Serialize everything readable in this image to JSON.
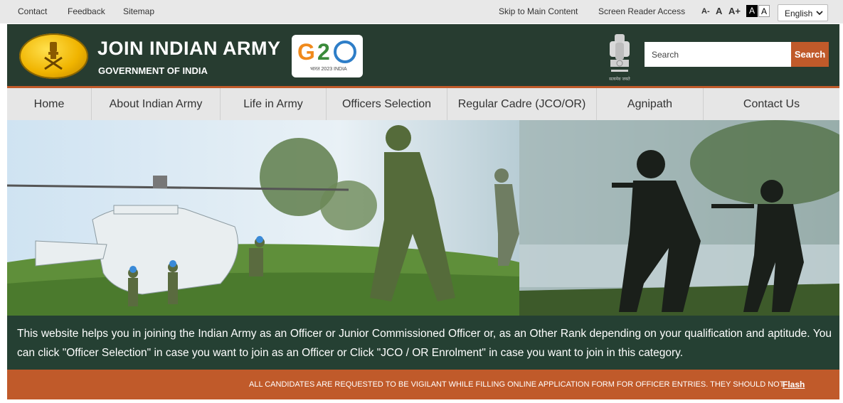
{
  "topbar": {
    "links": [
      "Contact",
      "Feedback",
      "Sitemap"
    ],
    "skip_link": "Skip to Main Content",
    "screen_reader": "Screen Reader Access",
    "font_decrease": "A-",
    "font_normal": "A",
    "font_increase": "A+",
    "contrast_dark": "A",
    "contrast_light": "A",
    "language": "English"
  },
  "header": {
    "title": "JOIN INDIAN ARMY",
    "subtitle": "GOVERNMENT OF INDIA",
    "g20_logo": "G20",
    "emblem_icon": "indian-army-emblem",
    "national_emblem_icon": "ashoka-emblem",
    "search_placeholder": "Search",
    "search_button": "Search"
  },
  "nav": {
    "items": [
      "Home",
      "About Indian Army",
      "Life in Army",
      "Officers Selection",
      "Regular Cadre (JCO/OR)",
      "Agnipath",
      "Contact Us"
    ]
  },
  "info": {
    "text": "This website helps you in joining the Indian Army as an Officer or Junior Commissioned Officer or, as an Other Rank depending on your qualification and aptitude. You can click \"Officer Selection\" in case you want to join as an Officer or Click \"JCO / OR Enrolment\" in case you want to join in this category."
  },
  "ticker": {
    "text": "ALL CANDIDATES ARE REQUESTED TO BE VIGILANT WHILE FILLING ONLINE APPLICATION FORM FOR OFFICER ENTRIES. THEY SHOULD NOT",
    "flash_label": "Flash"
  },
  "colors": {
    "header_bg": "#273c30",
    "accent": "#c05a2a",
    "info_bg": "#254033",
    "nav_bg": "#e6e6e6"
  }
}
